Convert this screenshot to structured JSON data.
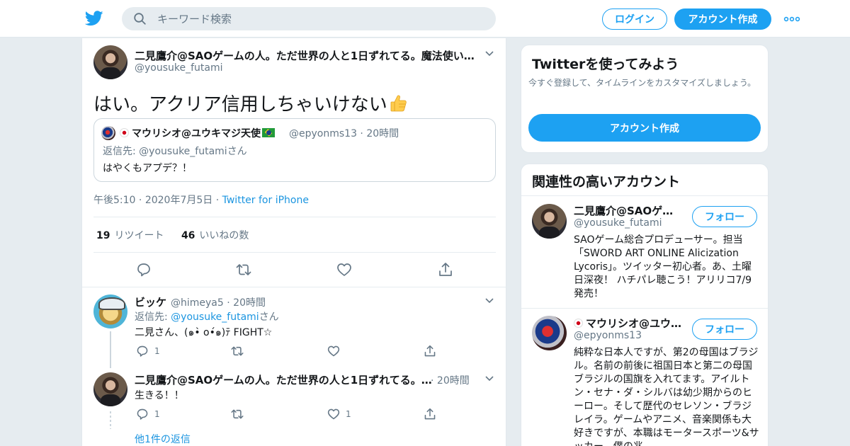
{
  "header": {
    "search_placeholder": "キーワード検索",
    "login_label": "ログイン",
    "signup_label": "アカウント作成"
  },
  "tweet": {
    "author_name": "二見鷹介@SAOゲームの人。ただ世界の人と1日ずれてる。魔法使い…",
    "author_handle": "@yousuke_futami",
    "text": "はい。アクリア信用しちゃいけない",
    "emoji": "thumbs-up",
    "quote": {
      "author_name": "マウリシオ@ユウキマジ天使",
      "author_handle": "@epyonms13",
      "time": "20時間",
      "reply_prefix": "返信先: ",
      "reply_to": "@yousuke_futami",
      "reply_suffix": "さん",
      "text": "はやくもアプデ？！"
    },
    "time": "午後5:10",
    "date": "2020年7月5日",
    "source": "Twitter for iPhone",
    "retweets_count": "19",
    "retweets_label": "リツイート",
    "likes_count": "46",
    "likes_label": "いいねの数"
  },
  "replies": [
    {
      "author_name": "ビッケ",
      "author_handle": "@himeya5",
      "time": "20時間",
      "reply_prefix": "返信先: ",
      "reply_to": "@yousuke_futami",
      "reply_suffix": "さん",
      "text": "二見さん、(๑•̀ o•́๑)ﾃ FIGHT☆",
      "reply_count": "1",
      "like_count": ""
    },
    {
      "author_name": "二見鷹介@SAOゲームの人。ただ世界の人と1日ずれてる。…",
      "author_handle": "",
      "time": "20時間",
      "text": "生きる！！",
      "reply_count": "1",
      "like_count": "1"
    }
  ],
  "more_replies_label": "他1件の返信",
  "sidebar": {
    "signup_card": {
      "title": "Twitterを使ってみよう",
      "subtitle": "今すぐ登録して、タイムラインをカスタマイズしましょう。",
      "button_label": "アカウント作成"
    },
    "related": {
      "title": "関連性の高いアカウント",
      "follow_label": "フォロー",
      "accounts": [
        {
          "name": "二見鷹介@SAOゲー…",
          "handle": "@yousuke_futami",
          "bio": "SAOゲーム総合プロデューサー。担当「SWORD ART ONLINE Alicization Lycoris」。ツイッター初心者。あ、土曜日深夜！ ハチパレ聴こう！アリリコ7/9発売！"
        },
        {
          "name": "マウリシオ@ユウ…",
          "handle": "@epyonms13",
          "bio": "純粋な日本人ですが、第2の母国はブラジル。名前の前後に祖国日本と第二の母国ブラジルの国旗を入れてます。アイルトン・セナ・ダ・シルバは幼少期からのヒーロー。そして歴代のセレソン・ブラジレイラ。ゲームやアニメ、音楽関係も大好きですが、本職はモータースポーツ&サッカー。僕の兆"
        }
      ]
    }
  },
  "colors": {
    "brand": "#1da1f2",
    "link": "#1b95e0",
    "muted": "#657786",
    "background": "#e6ecf0"
  }
}
